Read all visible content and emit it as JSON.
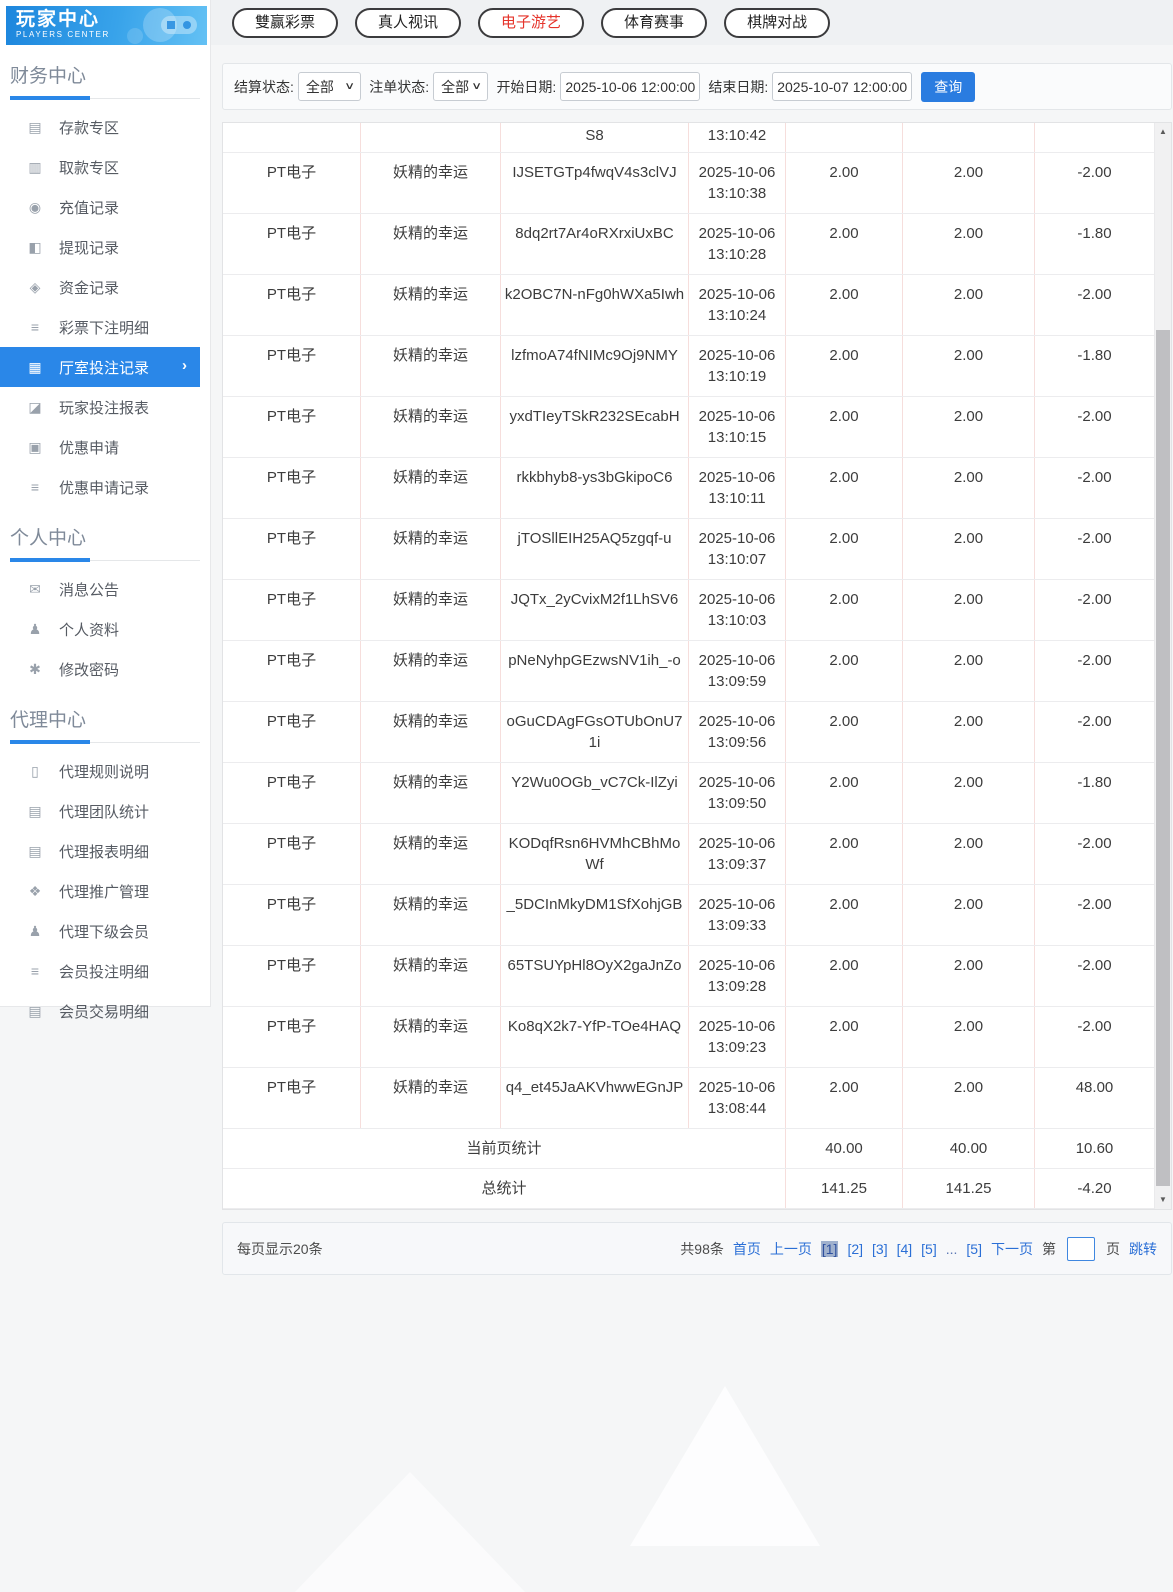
{
  "app": {
    "title": "玩家中心",
    "subtitle": "PLAYERS CENTER"
  },
  "icons": {
    "chevron_right": "›",
    "select_caret": "∨",
    "scroll_up": "▲",
    "scroll_down": "▼"
  },
  "colors": {
    "accent_blue": "#2a87e8",
    "button_blue": "#2a7ce0",
    "link_blue": "#2b6fd6",
    "active_tab_red": "#e5342b",
    "table_vline_pink": "#f6dedc",
    "active_page_bg": "#9fb0cd"
  },
  "nav": {
    "tabs": [
      {
        "name": "lottery",
        "label": "雙赢彩票",
        "active": false
      },
      {
        "name": "live-video",
        "label": "真人视讯",
        "active": false
      },
      {
        "name": "electronic-games",
        "label": "电子游艺",
        "active": true
      },
      {
        "name": "sports",
        "label": "体育赛事",
        "active": false
      },
      {
        "name": "board-games",
        "label": "棋牌对战",
        "active": false
      }
    ]
  },
  "filters": {
    "settle_label": "结算状态:",
    "settle_value": "全部",
    "order_label": "注单状态:",
    "order_value": "全部",
    "start_label": "开始日期:",
    "start_value": "2025-10-06 12:00:00",
    "end_label": "结束日期:",
    "end_value": "2025-10-07 12:00:00",
    "search_label": "查询"
  },
  "sidebar": {
    "sections": [
      {
        "title": "财务中心",
        "items": [
          {
            "name": "deposit-zone",
            "icon_name": "bank-card-icon",
            "icon": "▤",
            "label": "存款专区",
            "active": false
          },
          {
            "name": "withdraw-zone",
            "icon_name": "hand-card-icon",
            "icon": "▥",
            "label": "取款专区",
            "active": false
          },
          {
            "name": "recharge-records",
            "icon_name": "money-bag-icon",
            "icon": "◉",
            "label": "充值记录",
            "active": false
          },
          {
            "name": "withdrawal-records",
            "icon_name": "wallet-icon",
            "icon": "◧",
            "label": "提现记录",
            "active": false
          },
          {
            "name": "funds-records",
            "icon_name": "coin-purse-icon",
            "icon": "◈",
            "label": "资金记录",
            "active": false
          },
          {
            "name": "lottery-bet-details",
            "icon_name": "list-icon",
            "icon": "≡",
            "label": "彩票下注明细",
            "active": false
          },
          {
            "name": "venue-bet-records",
            "icon_name": "clipboard-list-icon",
            "icon": "▦",
            "label": "厅室投注记录",
            "active": true
          },
          {
            "name": "player-bet-report",
            "icon_name": "report-chart-icon",
            "icon": "◪",
            "label": "玩家投注报表",
            "active": false
          },
          {
            "name": "promo-application",
            "icon_name": "ticket-icon",
            "icon": "▣",
            "label": "优惠申请",
            "active": false
          },
          {
            "name": "promo-application-records",
            "icon_name": "records-icon",
            "icon": "≡",
            "label": "优惠申请记录",
            "active": false
          }
        ]
      },
      {
        "title": "个人中心",
        "items": [
          {
            "name": "announcements",
            "icon_name": "bell-icon",
            "icon": "✉",
            "label": "消息公告",
            "active": false
          },
          {
            "name": "profile",
            "icon_name": "user-icon",
            "icon": "♟",
            "label": "个人资料",
            "active": false
          },
          {
            "name": "change-password",
            "icon_name": "gear-icon",
            "icon": "✱",
            "label": "修改密码",
            "active": false
          }
        ]
      },
      {
        "title": "代理中心",
        "items": [
          {
            "name": "agent-rules",
            "icon_name": "document-icon",
            "icon": "▯",
            "label": "代理规则说明",
            "active": false
          },
          {
            "name": "agent-team-stats",
            "icon_name": "stats-book-icon",
            "icon": "▤",
            "label": "代理团队统计",
            "active": false
          },
          {
            "name": "agent-report-details",
            "icon_name": "report-book-icon",
            "icon": "▤",
            "label": "代理报表明细",
            "active": false
          },
          {
            "name": "agent-promotion",
            "icon_name": "share-icon",
            "icon": "❖",
            "label": "代理推广管理",
            "active": false
          },
          {
            "name": "agent-sub-members",
            "icon_name": "users-icon",
            "icon": "♟",
            "label": "代理下级会员",
            "active": false
          },
          {
            "name": "member-bet-details",
            "icon_name": "bet-detail-icon",
            "icon": "≡",
            "label": "会员投注明细",
            "active": false
          },
          {
            "name": "member-transaction-details",
            "icon_name": "transaction-icon",
            "icon": "▤",
            "label": "会员交易明细",
            "active": false
          }
        ]
      }
    ]
  },
  "table": {
    "partial_row": {
      "order_id_tail": "S8",
      "time_tail": "13:10:42"
    },
    "rows": [
      {
        "venue": "PT电子",
        "game": "妖精的幸运",
        "order_id": "IJSETGTp4fwqV4s3clVJ",
        "date": "2025-10-06",
        "time": "13:10:38",
        "bet": "2.00",
        "valid": "2.00",
        "winloss": "-2.00"
      },
      {
        "venue": "PT电子",
        "game": "妖精的幸运",
        "order_id": "8dq2rt7Ar4oRXrxiUxBC",
        "date": "2025-10-06",
        "time": "13:10:28",
        "bet": "2.00",
        "valid": "2.00",
        "winloss": "-1.80"
      },
      {
        "venue": "PT电子",
        "game": "妖精的幸运",
        "order_id": "k2OBC7N-nFg0hWXa5Iwh",
        "date": "2025-10-06",
        "time": "13:10:24",
        "bet": "2.00",
        "valid": "2.00",
        "winloss": "-2.00"
      },
      {
        "venue": "PT电子",
        "game": "妖精的幸运",
        "order_id": "lzfmoA74fNIMc9Oj9NMY",
        "date": "2025-10-06",
        "time": "13:10:19",
        "bet": "2.00",
        "valid": "2.00",
        "winloss": "-1.80"
      },
      {
        "venue": "PT电子",
        "game": "妖精的幸运",
        "order_id": "yxdTIeyTSkR232SEcabH",
        "date": "2025-10-06",
        "time": "13:10:15",
        "bet": "2.00",
        "valid": "2.00",
        "winloss": "-2.00"
      },
      {
        "venue": "PT电子",
        "game": "妖精的幸运",
        "order_id": "rkkbhyb8-ys3bGkipoC6",
        "date": "2025-10-06",
        "time": "13:10:11",
        "bet": "2.00",
        "valid": "2.00",
        "winloss": "-2.00"
      },
      {
        "venue": "PT电子",
        "game": "妖精的幸运",
        "order_id": "jTOSllEIH25AQ5zgqf-u",
        "date": "2025-10-06",
        "time": "13:10:07",
        "bet": "2.00",
        "valid": "2.00",
        "winloss": "-2.00"
      },
      {
        "venue": "PT电子",
        "game": "妖精的幸运",
        "order_id": "JQTx_2yCvixM2f1LhSV6",
        "date": "2025-10-06",
        "time": "13:10:03",
        "bet": "2.00",
        "valid": "2.00",
        "winloss": "-2.00"
      },
      {
        "venue": "PT电子",
        "game": "妖精的幸运",
        "order_id": "pNeNyhpGEzwsNV1ih_-o",
        "date": "2025-10-06",
        "time": "13:09:59",
        "bet": "2.00",
        "valid": "2.00",
        "winloss": "-2.00"
      },
      {
        "venue": "PT电子",
        "game": "妖精的幸运",
        "order_id": "oGuCDAgFGsOTUbOnU71i",
        "date": "2025-10-06",
        "time": "13:09:56",
        "bet": "2.00",
        "valid": "2.00",
        "winloss": "-2.00"
      },
      {
        "venue": "PT电子",
        "game": "妖精的幸运",
        "order_id": "Y2Wu0OGb_vC7Ck-IlZyi",
        "date": "2025-10-06",
        "time": "13:09:50",
        "bet": "2.00",
        "valid": "2.00",
        "winloss": "-1.80"
      },
      {
        "venue": "PT电子",
        "game": "妖精的幸运",
        "order_id": "KODqfRsn6HVMhCBhMoWf",
        "date": "2025-10-06",
        "time": "13:09:37",
        "bet": "2.00",
        "valid": "2.00",
        "winloss": "-2.00"
      },
      {
        "venue": "PT电子",
        "game": "妖精的幸运",
        "order_id": "_5DCInMkyDM1SfXohjGB",
        "date": "2025-10-06",
        "time": "13:09:33",
        "bet": "2.00",
        "valid": "2.00",
        "winloss": "-2.00"
      },
      {
        "venue": "PT电子",
        "game": "妖精的幸运",
        "order_id": "65TSUYpHl8OyX2gaJnZo",
        "date": "2025-10-06",
        "time": "13:09:28",
        "bet": "2.00",
        "valid": "2.00",
        "winloss": "-2.00"
      },
      {
        "venue": "PT电子",
        "game": "妖精的幸运",
        "order_id": "Ko8qX2k7-YfP-TOe4HAQ",
        "date": "2025-10-06",
        "time": "13:09:23",
        "bet": "2.00",
        "valid": "2.00",
        "winloss": "-2.00"
      },
      {
        "venue": "PT电子",
        "game": "妖精的幸运",
        "order_id": "q4_et45JaAKVhwwEGnJP",
        "date": "2025-10-06",
        "time": "13:08:44",
        "bet": "2.00",
        "valid": "2.00",
        "winloss": "48.00"
      }
    ],
    "summary": [
      {
        "label": "当前页统计",
        "bet": "40.00",
        "valid": "40.00",
        "winloss": "10.60"
      },
      {
        "label": "总统计",
        "bet": "141.25",
        "valid": "141.25",
        "winloss": "-4.20"
      }
    ]
  },
  "pagination": {
    "per_page": "每页显示20条",
    "total": "共98条",
    "first": "首页",
    "prev": "上一页",
    "pages": [
      {
        "label": "[1]",
        "active": true
      },
      {
        "label": "[2]",
        "active": false
      },
      {
        "label": "[3]",
        "active": false
      },
      {
        "label": "[4]",
        "active": false
      },
      {
        "label": "[5]",
        "active": false
      },
      {
        "label": "...",
        "active": false
      },
      {
        "label": "[5]",
        "active": false
      }
    ],
    "next": "下一页",
    "jump_prefix": "第",
    "jump_suffix": "页",
    "jump_action": "跳转",
    "jump_value": ""
  }
}
